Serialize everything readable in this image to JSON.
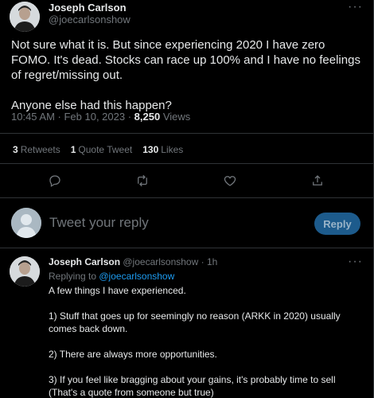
{
  "tweet": {
    "author_name": "Joseph Carlson",
    "author_handle": "@joecarlsonshow",
    "more_icon": "more-horizontal-icon",
    "text_paragraphs": [
      "Not sure what it is. But since experiencing 2020 I have zero FOMO. It's dead. Stocks can race up 100% and I have no feelings of regret/missing out.",
      "Anyone else had this happen?"
    ],
    "timestamp": "10:45 AM · Feb 10, 2023 · ",
    "views_count": "8,250",
    "views_label": " Views"
  },
  "stats": {
    "retweets_count": "3",
    "retweets_label": "Retweets",
    "quotes_count": "1",
    "quotes_label": "Quote Tweet",
    "likes_count": "130",
    "likes_label": "Likes"
  },
  "actions": [
    {
      "icon": "reply-icon"
    },
    {
      "icon": "retweet-icon"
    },
    {
      "icon": "like-icon"
    },
    {
      "icon": "share-icon"
    }
  ],
  "composer": {
    "placeholder": "Tweet your reply",
    "button_label": "Reply"
  },
  "reply": {
    "author_name": "Joseph Carlson",
    "author_handle": "@joecarlsonshow",
    "separator": " · ",
    "time_ago": "1h",
    "replying_to_label": "Replying to ",
    "replying_to_mention": "@joecarlsonshow",
    "text_paragraphs": [
      "A few things I have experienced.",
      "1) Stuff that goes up for seemingly no reason (ARKK in 2020) usually comes back down.",
      "2) There are always more opportunities.",
      "3) If you feel like bragging about your gains, it's probably time to sell (That's a quote from someone but true)"
    ]
  },
  "colors": {
    "background": "#000000",
    "text": "#e7e9ea",
    "muted": "#71767b",
    "accent": "#1d9bf0",
    "reply_button": "#1d5b8c"
  }
}
